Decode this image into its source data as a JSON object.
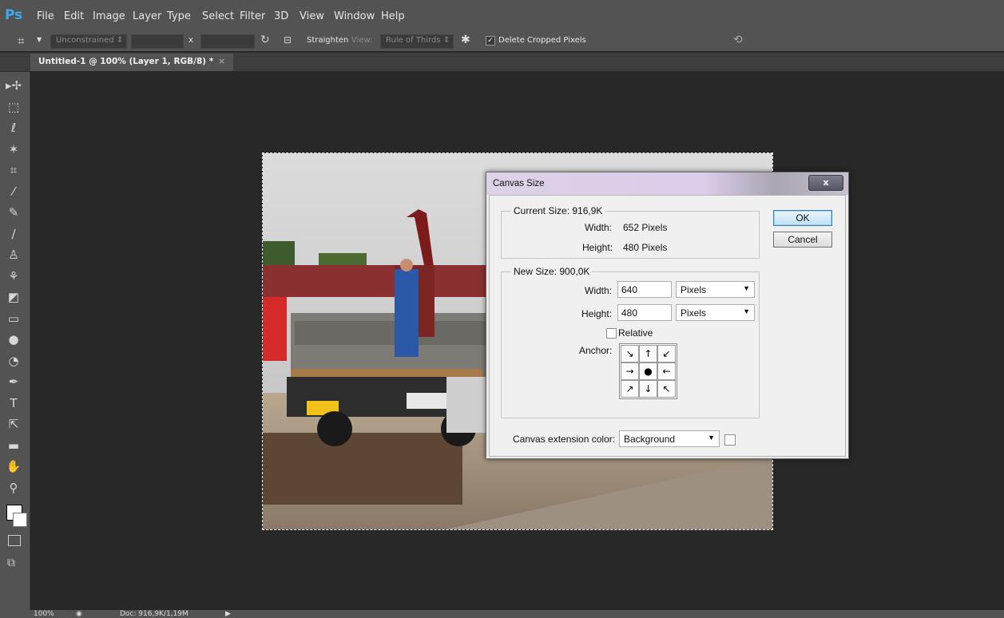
{
  "app": {
    "logo": "Ps"
  },
  "menu": [
    "File",
    "Edit",
    "Image",
    "Layer",
    "Type",
    "Select",
    "Filter",
    "3D",
    "View",
    "Window",
    "Help"
  ],
  "options": {
    "ratio": "Unconstrained",
    "ratio_arrow": "⇕",
    "x_sep": "x",
    "straighten": "Straighten",
    "view_label": "View:",
    "view_value": "Rule of Thirds",
    "delete_cropped": "Delete Cropped Pixels",
    "delete_cropped_checked": true
  },
  "document_tab": {
    "title": "Untitled-1 @ 100% (Layer 1, RGB/8) *",
    "close": "×"
  },
  "tools": [
    "move-icon",
    "marquee-icon",
    "lasso-icon",
    "magic-wand-icon",
    "crop-icon",
    "eyedropper-icon",
    "healing-icon",
    "brush-icon",
    "stamp-icon",
    "history-brush-icon",
    "eraser-icon",
    "gradient-icon",
    "blur-icon",
    "dodge-icon",
    "pen-icon",
    "type-icon",
    "path-select-icon",
    "shape-icon",
    "hand-icon",
    "zoom-icon"
  ],
  "tool_glyphs": [
    "▸✢",
    "⬚",
    "ℓ",
    "✶",
    "⌗",
    "⁄",
    "✎",
    "/",
    "♙",
    "⚘",
    "◩",
    "▭",
    "●",
    "◔",
    "✒",
    "T",
    "⇱",
    "▬",
    "✋",
    "⚲"
  ],
  "dialog": {
    "title": "Canvas Size",
    "close": "x",
    "current_size_label": "Current Size: 916,9K",
    "current_width_label": "Width:",
    "current_width_value": "652 Pixels",
    "current_height_label": "Height:",
    "current_height_value": "480 Pixels",
    "new_size_label": "New Size: 900,0K",
    "width_label": "Width:",
    "width_value": "640",
    "width_unit": "Pixels",
    "height_label": "Height:",
    "height_value": "480",
    "height_unit": "Pixels",
    "relative_label": "Relative",
    "relative_checked": false,
    "anchor_label": "Anchor:",
    "anchor_cells": [
      "↘",
      "↑",
      "↙",
      "→",
      "●",
      "←",
      "↗",
      "↓",
      "↖"
    ],
    "extension_label": "Canvas extension color:",
    "extension_value": "Background",
    "ok": "OK",
    "cancel": "Cancel"
  },
  "status": {
    "zoom": "100%",
    "doc": "Doc: 916,9K/1,19M"
  }
}
